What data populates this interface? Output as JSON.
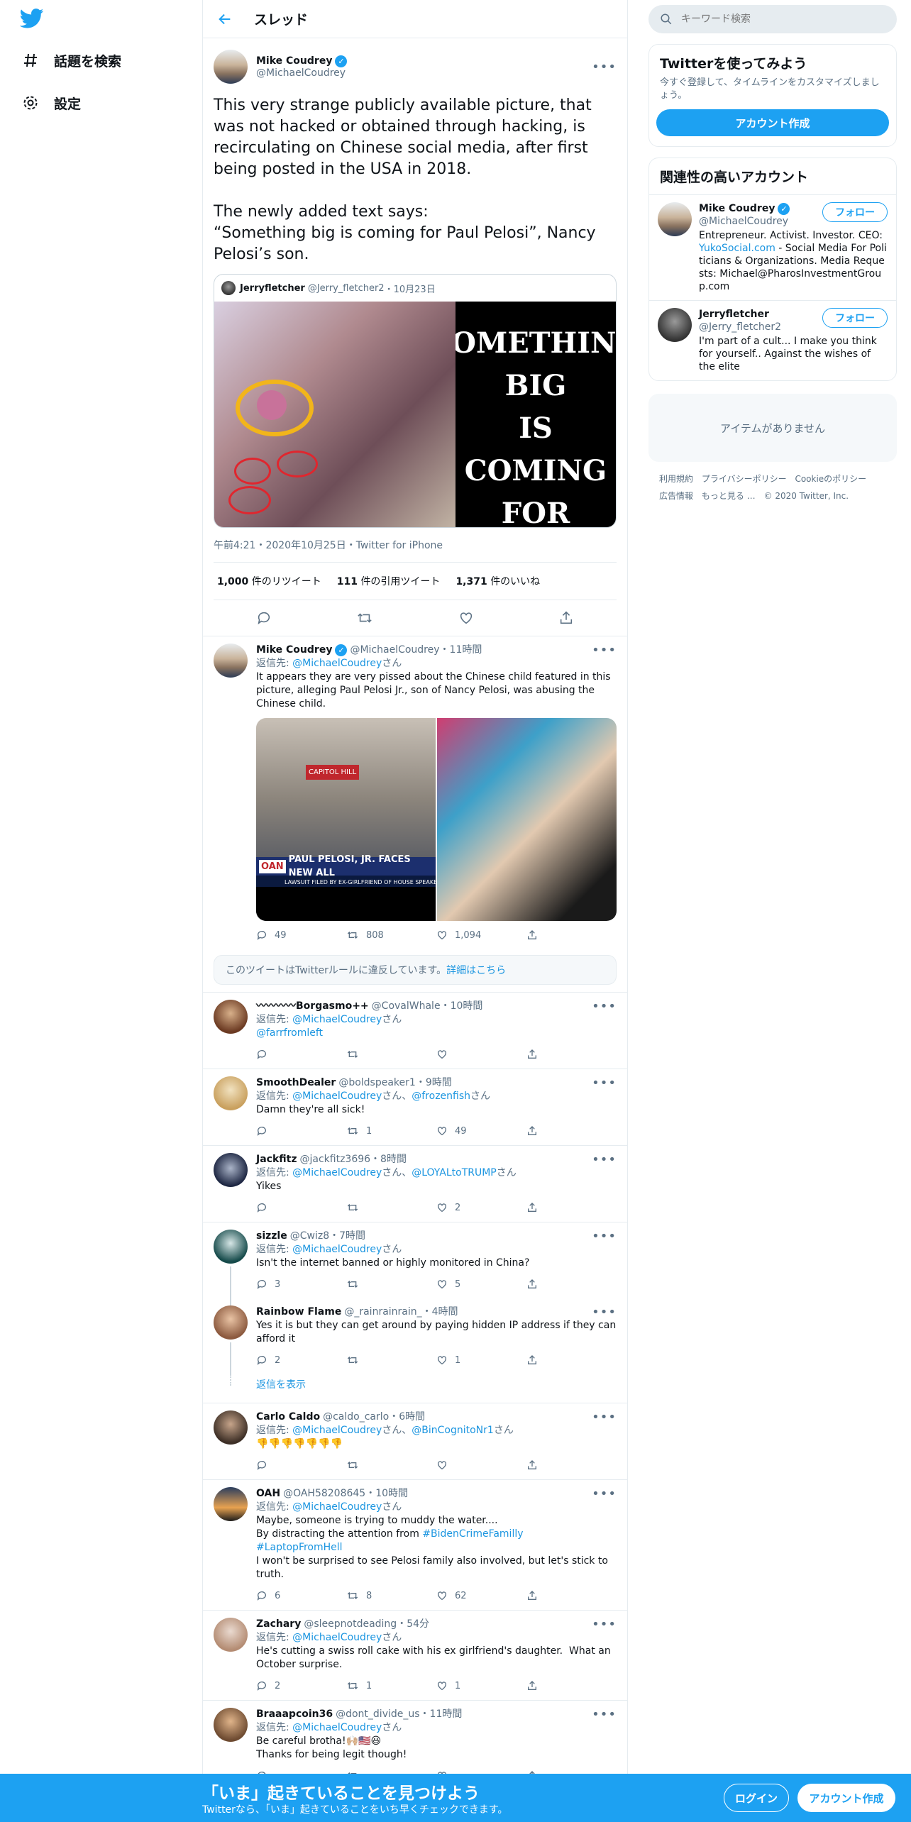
{
  "nav": {
    "explore": "話題を検索",
    "settings": "設定"
  },
  "header": {
    "title": "スレッド"
  },
  "main_tweet": {
    "name": "Mike Coudrey",
    "handle": "@MichaelCoudrey",
    "text": "This very strange publicly available picture, that was not hacked or obtained through hacking, is recirculating on Chinese social media, after first being posted in the USA in 2018.\n\nThe newly added text says:\n“Something big is coming for Paul Pelosi”, Nancy Pelosi’s son.",
    "quote": {
      "name": "Jerryfletcher",
      "handle": "@Jerry_fletcher2",
      "time": "10月23日",
      "image_text": [
        "SOMETHING",
        "BIG",
        "IS COMING",
        "FOR"
      ]
    },
    "meta": "午前4:21・2020年10月25日・Twitter for iPhone",
    "retweets": "1,000",
    "retweets_label": "件のリツイート",
    "quotes": "111",
    "quotes_label": "件の引用ツイート",
    "likes": "1,371",
    "likes_label": "件のいいね"
  },
  "self_reply": {
    "name": "Mike Coudrey",
    "handle": "@MichaelCoudrey",
    "time": "11時間",
    "reply_prefix": "返信先: ",
    "reply_to": "@MichaelCoudrey",
    "reply_suffix": "さん",
    "text": "It appears they are very pissed about the Chinese child featured in this picture, alleging Paul Pelosi Jr., son of Nancy Pelosi, was abusing the Chinese child.",
    "media_caption_top": "CAPITOL HILL",
    "media_caption": "PAUL PELOSI, JR. FACES NEW ALL",
    "media_sub": "LAWSUIT FILED BY EX-GIRLFRIEND OF HOUSE SPEAKER'S SON WHICH AL",
    "oan": "OAN",
    "replies": "49",
    "retweets": "808",
    "likes": "1,094"
  },
  "notice": {
    "text": "このツイートはTwitterルールに違反しています。",
    "link": "詳細はこちら"
  },
  "replies": [
    {
      "name": "〰〰〰〰Borgasmo++",
      "handle": "@CovalWhale",
      "time": "10時間",
      "reply_to": "@MichaelCoudrey",
      "reply_to2": "",
      "text": "@farrfromleft",
      "text_is_link": true,
      "r": "",
      "rt": "",
      "l": ""
    },
    {
      "name": "SmoothDealer",
      "handle": "@boldspeaker1",
      "time": "9時間",
      "reply_to": "@MichaelCoudrey",
      "reply_to2": "@frozenfish",
      "text": "Damn they're all sick!",
      "r": "",
      "rt": "1",
      "l": "49"
    },
    {
      "name": "Jackfitz",
      "handle": "@jackfitz3696",
      "time": "8時間",
      "reply_to": "@MichaelCoudrey",
      "reply_to2": "@LOYALtoTRUMP",
      "text": "Yikes",
      "r": "",
      "rt": "",
      "l": "2"
    },
    {
      "name": "sizzle",
      "handle": "@Cwiz8",
      "time": "7時間",
      "reply_to": "@MichaelCoudrey",
      "reply_to2": "",
      "text": "Isn't the internet banned or highly monitored in China?",
      "r": "3",
      "rt": "",
      "l": "5"
    },
    {
      "name": "Rainbow Flame",
      "handle": "@_rainrainrain_",
      "time": "4時間",
      "reply_to": "",
      "reply_to2": "",
      "text": "Yes it is but they can get around by paying hidden IP address if they can afford it",
      "r": "2",
      "rt": "",
      "l": "1"
    },
    {
      "name": "Carlo Caldo",
      "handle": "@caldo_carlo",
      "time": "6時間",
      "reply_to": "@MichaelCoudrey",
      "reply_to2": "@BinCognitoNr1",
      "text": "👎👎👎👎👎👎👎",
      "r": "",
      "rt": "",
      "l": ""
    },
    {
      "name": "OAH",
      "handle": "@OAH58208645",
      "time": "10時間",
      "reply_to": "@MichaelCoudrey",
      "reply_to2": "",
      "text": "Maybe, someone is trying to muddy the water....\nBy distracting the attention from ",
      "hashtag1": "#BidenCrimeFamilly",
      "hashtag2": "#LaptopFromHell",
      "text2": "I won't be surprised to see Pelosi family also involved, but let's stick to truth.",
      "r": "6",
      "rt": "8",
      "l": "62"
    },
    {
      "name": "Zachary",
      "handle": "@sleepnotdeading",
      "time": "54分",
      "reply_to": "@MichaelCoudrey",
      "reply_to2": "",
      "text": "He's cutting a swiss roll cake with his ex girlfriend's daughter.  What an October surprise.",
      "r": "2",
      "rt": "1",
      "l": "1"
    },
    {
      "name": "Braaapcoin36",
      "handle": "@dont_divide_us",
      "time": "11時間",
      "reply_to": "@MichaelCoudrey",
      "reply_to2": "",
      "text": "Be careful brotha!🙌🏼🇺🇸😃\nThanks for being legit though!",
      "r": "",
      "rt": "",
      "l": ""
    }
  ],
  "common": {
    "reply_prefix": "返信先: ",
    "san": "さん",
    "san_comma": "さん、",
    "dot": "・",
    "show_replies": "返信を表示"
  },
  "right": {
    "search_placeholder": "キーワード検索",
    "signup_card": {
      "title": "Twitterを使ってみよう",
      "sub": "今すぐ登録して、タイムラインをカスタマイズしましょう。",
      "button": "アカウント作成"
    },
    "related": {
      "title": "関連性の高いアカウント",
      "follow": "フォロー",
      "accounts": [
        {
          "name": "Mike Coudrey",
          "handle": "@MichaelCoudrey",
          "bio1": "Entrepreneur. Activist. Investor. CEO: ",
          "bio_link": "YukoSocial.com",
          "bio2": " - Social Media For Politicians & Organizations. Media Requests: Michael@PharosInvestmentGroup.com"
        },
        {
          "name": "Jerryfletcher",
          "handle": "@Jerry_fletcher2",
          "bio1": "I'm part of a cult... I make you think for yourself.. Against the wishes of the elite",
          "bio_link": "",
          "bio2": ""
        }
      ]
    },
    "empty": "アイテムがありません",
    "footer": [
      "利用規約",
      "プライバシーポリシー",
      "Cookieのポリシー",
      "広告情報",
      "もっと見る …",
      "© 2020 Twitter, Inc."
    ]
  },
  "bottom": {
    "title": "「いま」起きていることを見つけよう",
    "sub": "Twitterなら、「いま」起きていることをいち早くチェックできます。",
    "login": "ログイン",
    "signup": "アカウント作成"
  },
  "colors": {
    "brand": "#1da1f2",
    "link": "#1b95e0",
    "muted": "#5b7083"
  }
}
